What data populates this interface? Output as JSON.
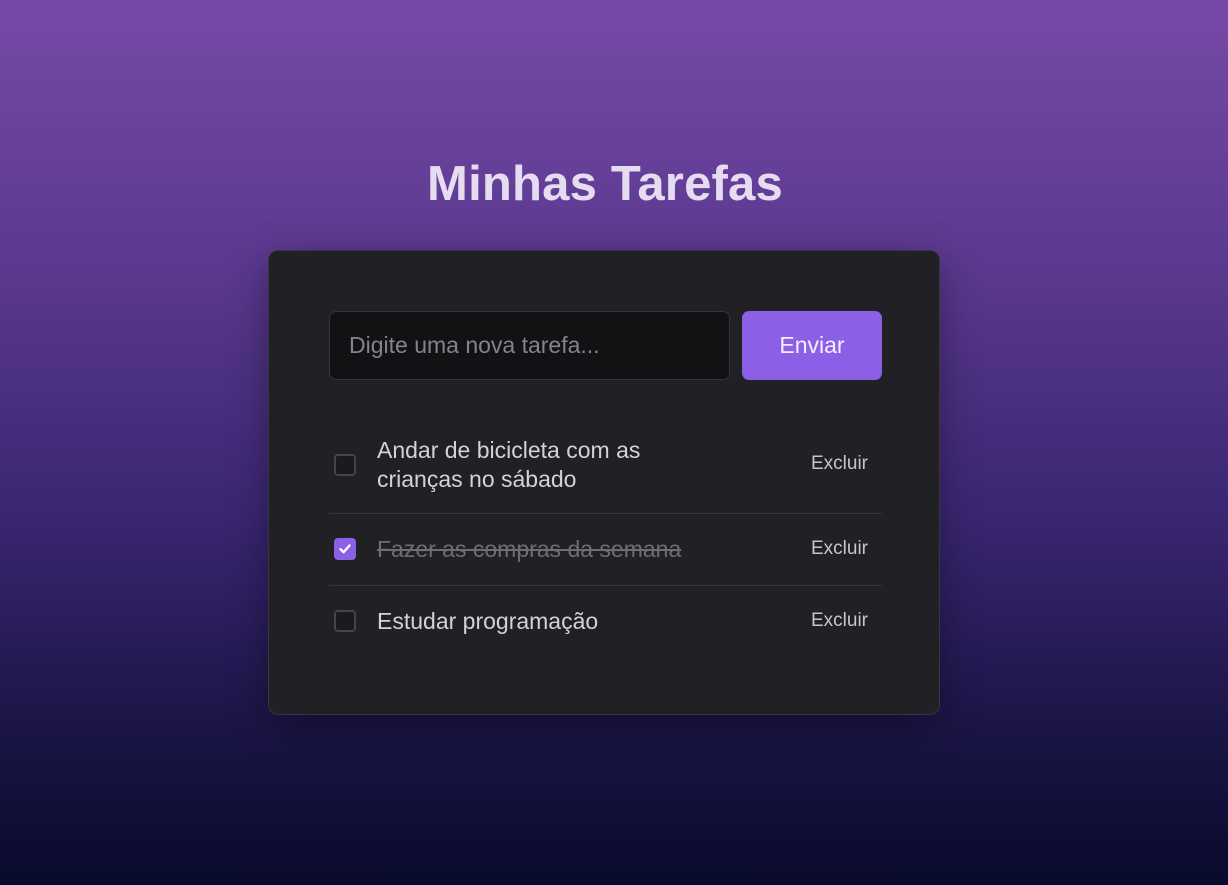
{
  "page": {
    "title": "Minhas Tarefas"
  },
  "form": {
    "input_value": "",
    "input_placeholder": "Digite uma nova tarefa...",
    "send_label": "Enviar"
  },
  "tasks": [
    {
      "text": "Andar de bicicleta com as crianças no sábado",
      "done": false,
      "delete_label": "Excluir"
    },
    {
      "text": "Fazer as compras da semana",
      "done": true,
      "delete_label": "Excluir"
    },
    {
      "text": "Estudar programação",
      "done": false,
      "delete_label": "Excluir"
    }
  ],
  "colors": {
    "accent": "#8b5fe6",
    "card_background": "#212024",
    "title_text": "#e6dcf1"
  },
  "icons": {
    "checked_mark": "check-icon"
  }
}
